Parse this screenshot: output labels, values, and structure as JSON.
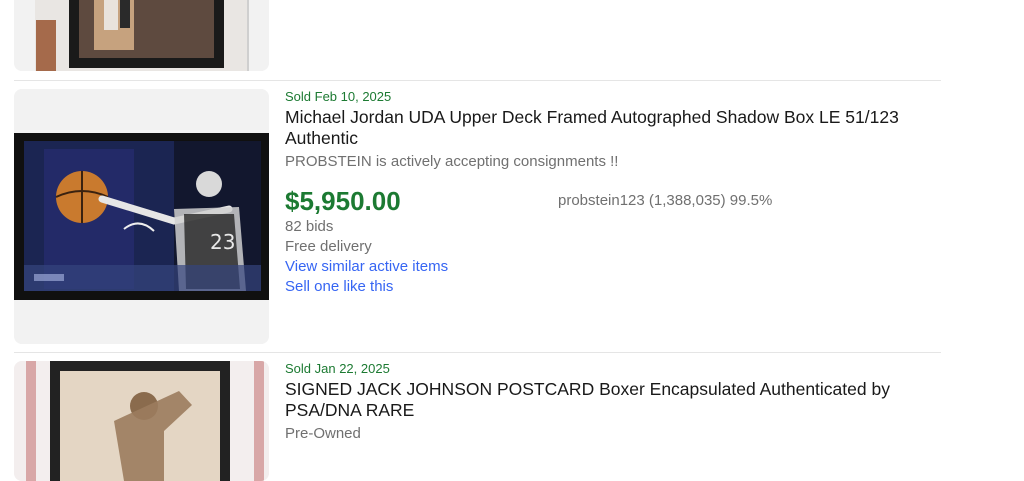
{
  "listings": [
    {
      "sold_date": "",
      "title": "",
      "image_alt": "Framed photo with signed memorabilia"
    },
    {
      "sold_date": "Sold Feb 10, 2025",
      "title": "Michael Jordan UDA Upper Deck Framed Autographed Shadow Box LE 51/123 Authentic",
      "subtitle": "PROBSTEIN is actively accepting consignments !!",
      "price": "$5,950.00",
      "bids": "82 bids",
      "delivery": "Free delivery",
      "view_similar": "View similar active items",
      "sell_one": "Sell one like this",
      "seller": "probstein123 (1,388,035) 99.5%",
      "jersey_number": "23"
    },
    {
      "sold_date": "Sold Jan 22, 2025",
      "title": "SIGNED JACK JOHNSON POSTCARD Boxer Encapsulated Authenticated by PSA/DNA RARE",
      "condition": "Pre-Owned"
    }
  ],
  "colors": {
    "sold_green": "#1c7a32",
    "link_blue": "#3665f3",
    "muted_text": "#707070"
  }
}
